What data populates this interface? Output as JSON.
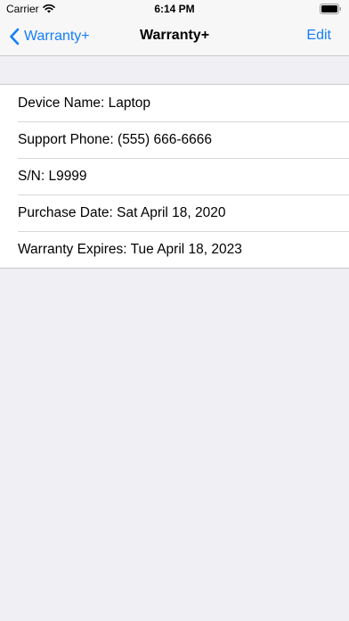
{
  "status_bar": {
    "carrier": "Carrier",
    "time": "6:14 PM"
  },
  "nav": {
    "back_label": "Warranty+",
    "title": "Warranty+",
    "edit_label": "Edit"
  },
  "details": {
    "device_name": "Device Name: Laptop",
    "support_phone": "Support Phone: (555) 666-6666",
    "serial": "S/N: L9999",
    "purchase_date": "Purchase Date: Sat April 18, 2020",
    "warranty_expires": "Warranty Expires: Tue April 18, 2023"
  },
  "colors": {
    "accent": "#147efb",
    "background": "#efeff4"
  },
  "icons": [
    "wifi-icon",
    "battery-icon",
    "chevron-left-icon"
  ]
}
